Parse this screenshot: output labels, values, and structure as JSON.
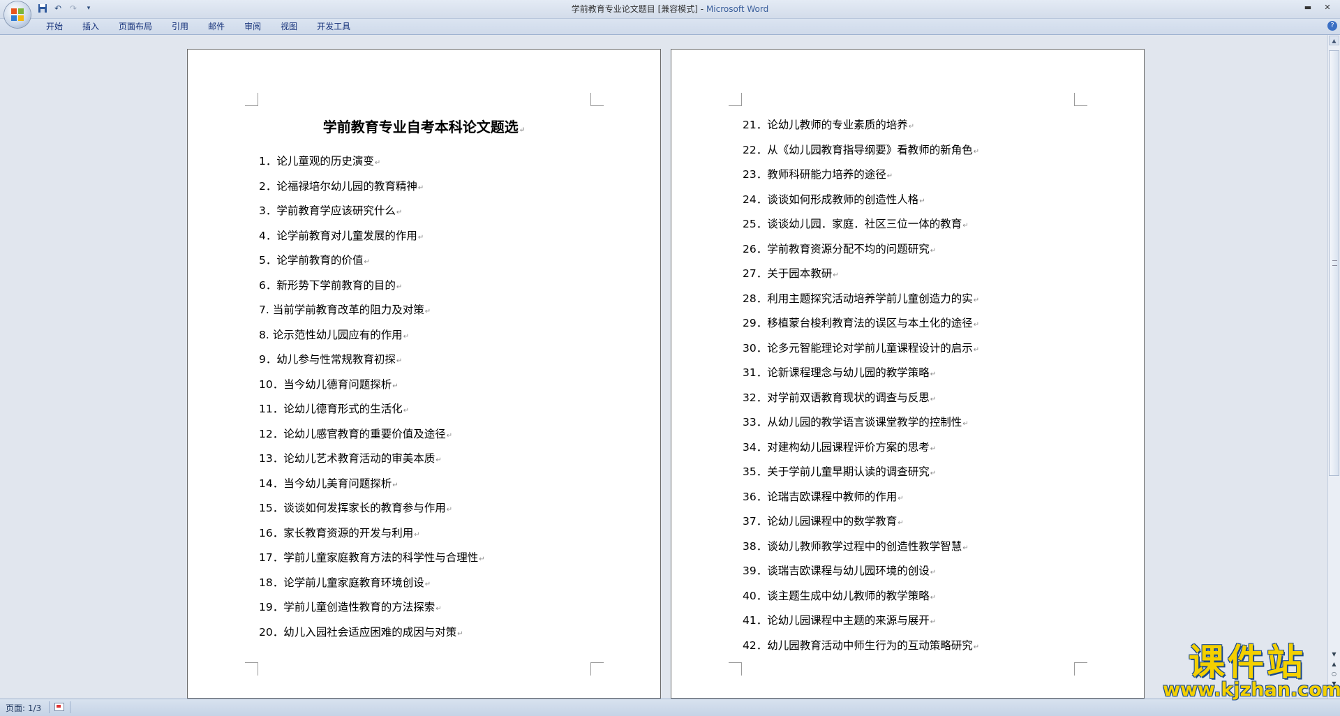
{
  "window": {
    "title": "学前教育专业论文题目 [兼容模式]",
    "app_name": "Microsoft Word",
    "minimize_icon": "minimize-icon",
    "close_icon": "close-icon"
  },
  "quick_access": {
    "icons": [
      "save-icon",
      "undo-icon",
      "redo-icon",
      "customize-dropdown-icon"
    ]
  },
  "ribbon": {
    "tabs": [
      "开始",
      "插入",
      "页面布局",
      "引用",
      "邮件",
      "审阅",
      "视图",
      "开发工具"
    ],
    "help_icon": "help-icon"
  },
  "document": {
    "title": "学前教育专业自考本科论文题选",
    "paragraph_mark": "↵",
    "items_page1": [
      "1．论儿童观的历史演变",
      "2．论福禄培尔幼儿园的教育精神",
      "3．学前教育学应该研究什么",
      "4．论学前教育对儿童发展的作用",
      "5．论学前教育的价值",
      "6．新形势下学前教育的目的",
      "7. 当前学前教育改革的阻力及对策",
      "8. 论示范性幼儿园应有的作用",
      "9．幼儿参与性常规教育初探",
      "10．当今幼儿德育问题探析",
      "11．论幼儿德育形式的生活化",
      "12．论幼儿感官教育的重要价值及途径",
      "13．论幼儿艺术教育活动的审美本质",
      "14．当今幼儿美育问题探析",
      "15．谈谈如何发挥家长的教育参与作用",
      "16．家长教育资源的开发与利用",
      "17．学前儿童家庭教育方法的科学性与合理性",
      "18．论学前儿童家庭教育环境创设",
      "19．学前儿童创造性教育的方法探索",
      "20．幼儿入园社会适应困难的成因与对策"
    ],
    "items_page2": [
      "21．论幼儿教师的专业素质的培养",
      "22．从《幼儿园教育指导纲要》看教师的新角色",
      "23．教师科研能力培养的途径",
      "24．谈谈如何形成教师的创造性人格",
      "25．谈谈幼儿园．家庭．社区三位一体的教育",
      "26．学前教育资源分配不均的问题研究",
      "27．关于园本教研",
      "28．利用主题探究活动培养学前儿童创造力的实",
      "29．移植蒙台梭利教育法的误区与本土化的途径",
      "30．论多元智能理论对学前儿童课程设计的启示",
      "31．论新课程理念与幼儿园的教学策略",
      "32．对学前双语教育现状的调查与反思",
      "33．从幼儿园的教学语言谈课堂教学的控制性",
      "34．对建构幼儿园课程评价方案的思考",
      "35．关于学前儿童早期认读的调查研究",
      "36．论瑞吉欧课程中教师的作用",
      "37．论幼儿园课程中的数学教育",
      "38．谈幼儿教师教学过程中的创造性教学智慧",
      "39．谈瑞吉欧课程与幼儿园环境的创设",
      "40．谈主题生成中幼儿教师的教学策略",
      "41．论幼儿园课程中主题的来源与展开",
      "42．幼儿园教育活动中师生行为的互动策略研究"
    ]
  },
  "statusbar": {
    "page_info": "页面: 1/3",
    "proofing_icon": "proofing-icon"
  },
  "watermark": {
    "title": "课件站",
    "url": "www.kjzhan.com"
  },
  "colors": {
    "app_title": "#3b5f9c",
    "tab_text": "#15317a",
    "watermark_fill": "#f4d000",
    "watermark_outline": "#1b4a8c"
  }
}
